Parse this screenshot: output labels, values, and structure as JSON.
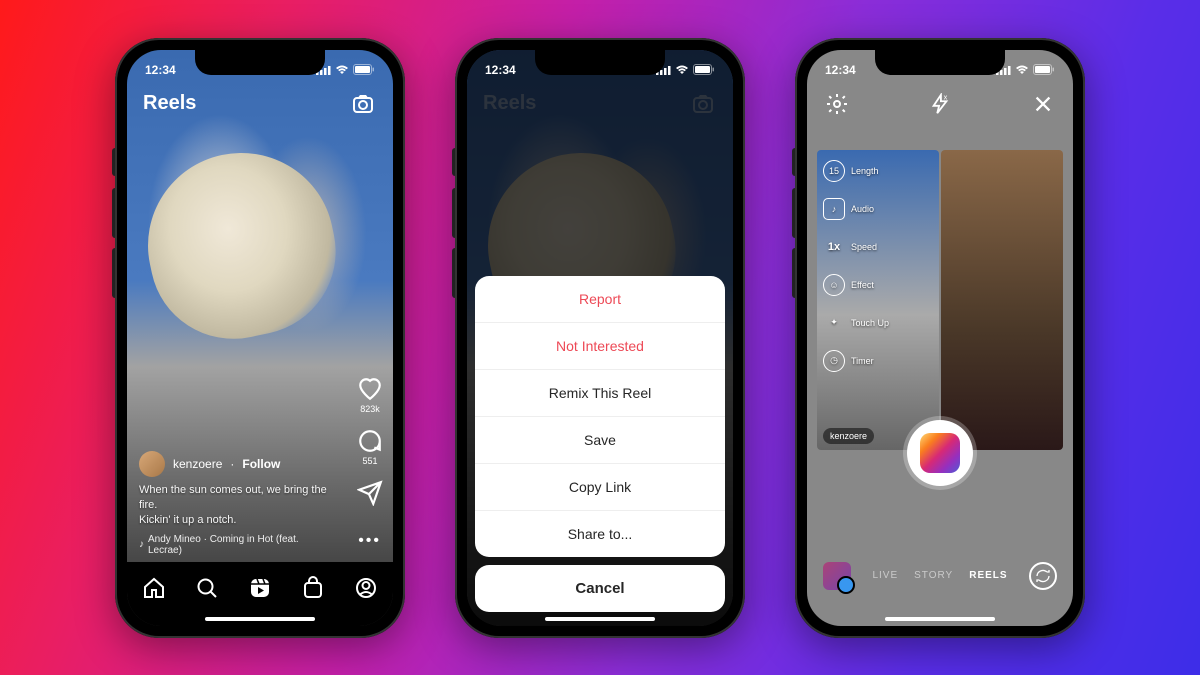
{
  "status": {
    "time": "12:34"
  },
  "phone1": {
    "header": {
      "title": "Reels"
    },
    "rail": {
      "likes": "823k",
      "comments": "551"
    },
    "meta": {
      "username": "kenzoere",
      "follow": "Follow",
      "caption_l1": "When the sun comes out, we bring the fire.",
      "caption_l2": "Kickin' it up a notch.",
      "audio": "Andy Mineo · Coming in Hot (feat. Lecrae)"
    }
  },
  "phone2": {
    "header": {
      "title": "Reels"
    },
    "sheet": {
      "report": "Report",
      "not_interested": "Not Interested",
      "remix": "Remix This Reel",
      "save": "Save",
      "copy_link": "Copy Link",
      "share_to": "Share to...",
      "cancel": "Cancel"
    }
  },
  "phone3": {
    "tools": {
      "length_val": "15",
      "length": "Length",
      "audio": "Audio",
      "speed_val": "1x",
      "speed": "Speed",
      "effect": "Effect",
      "touchup": "Touch Up",
      "timer": "Timer"
    },
    "user_tag": "kenzoere",
    "modes": {
      "live": "LIVE",
      "story": "STORY",
      "reels": "REELS"
    }
  }
}
